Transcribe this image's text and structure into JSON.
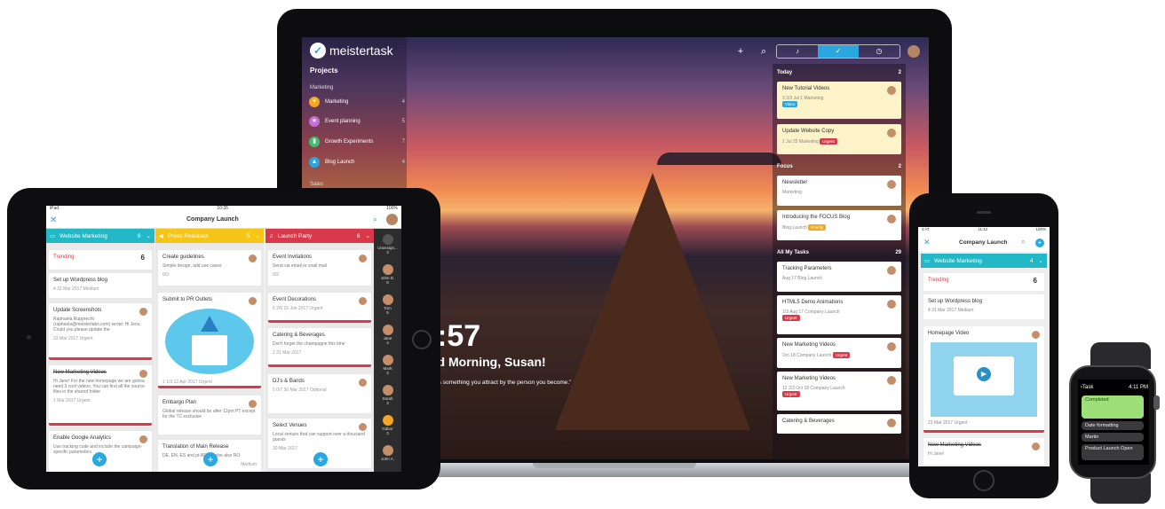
{
  "laptop": {
    "brand": "meistertask",
    "sidebar": {
      "projects_label": "Projects",
      "section_marketing": "Marketing",
      "items": [
        {
          "label": "Marketing",
          "count": "4",
          "icon": "megaphone-icon",
          "color": "#f5a623"
        },
        {
          "label": "Event planning",
          "count": "5",
          "icon": "star-icon",
          "color": "#c86dd7"
        },
        {
          "label": "Growth Experiments",
          "count": "7",
          "icon": "chart-icon",
          "color": "#3fbf6b"
        },
        {
          "label": "Blog Launch",
          "count": "4",
          "icon": "rocket-icon",
          "color": "#2aa7e0"
        }
      ],
      "section_sales": "Sales"
    },
    "clock": ":57",
    "greeting": "od Morning, Susan!",
    "quote": "ss is something you attract by the person you become.\"",
    "panel": {
      "today": {
        "label": "Today",
        "count": "2"
      },
      "focus": {
        "label": "Focus",
        "count": "2"
      },
      "mytasks": {
        "label": "All My Tasks",
        "count": "29"
      },
      "cards": [
        {
          "title": "New Tutorial Videos",
          "meta": "3   3/3   Jul 1   Marketing",
          "tag": "Video",
          "tag_color": "#2aa7e0"
        },
        {
          "title": "Update Website Copy",
          "meta": "1   Jul 25   Marketing",
          "tag": "Urgent",
          "tag_color": "#d93a4b"
        },
        {
          "title": "Newsletter",
          "meta": "Marketing",
          "tag": "",
          "tag_color": ""
        },
        {
          "title": "Introducing the FOCUS Blog",
          "meta": "Blog Launch",
          "tag": "Priority",
          "tag_color": "#f5a623"
        },
        {
          "title": "Tracking Parameters",
          "meta": "Aug 17   Blog Launch",
          "tag": "",
          "tag_color": ""
        },
        {
          "title": "HTML5 Demo Animations",
          "meta": "1/3   Aug 17   Company Launch",
          "tag": "Urgent",
          "tag_color": "#d93a4b"
        },
        {
          "title": "New Marketing Videos",
          "meta": "Oct 18   Company Launch",
          "tag": "Urgent",
          "tag_color": "#d93a4b"
        },
        {
          "title": "New Marketing Videos",
          "meta": "12   2/3   Oct 18   Company Launch",
          "tag": "Urgent",
          "tag_color": "#d93a4b"
        },
        {
          "title": "Catering & Beverages",
          "meta": "",
          "tag": "",
          "tag_color": ""
        }
      ]
    }
  },
  "tablet": {
    "status_left": "iPad",
    "status_time": "10:35",
    "status_right": "100%",
    "title": "Company Launch",
    "columns": [
      {
        "name": "Website Marketing",
        "count": "6",
        "color": "#23b8c6",
        "cards": [
          {
            "title": "Trending",
            "desc": "",
            "meta": "",
            "value": "6"
          },
          {
            "title": "Set up Wordpress blog",
            "desc": "",
            "meta": "4   31 Mar 2017   Medium"
          },
          {
            "title": "Update Screenshots",
            "desc": "Raphaela Rupprecht (raphaela@meisterlabs.com) wrote: Hi Jens, Could you please update the",
            "meta": "23 Mar 2017   Urgent"
          },
          {
            "title": "New Marketing Videos",
            "desc": "Hi Jane! For the new homepage we are gonna need 3 cool videos. You can find all the source files in the shared folder",
            "meta": "1 Mar 2017   Urgent"
          },
          {
            "title": "Enable Google Analytics",
            "desc": "Use tracking code and include the campaign-specific parameters",
            "meta": ""
          }
        ]
      },
      {
        "name": "Press Releases",
        "count": "5",
        "color": "#f5c518",
        "cards": [
          {
            "title": "Create guidelines",
            "desc": "Simple design, add use cases",
            "meta": "0/3"
          },
          {
            "title": "Submit to PR Outlets",
            "desc": "",
            "meta": "1   1/3   12 Apr 2017   Urgent"
          },
          {
            "title": "Embargo Plan",
            "desc": "Global release should be after 12pm PT except for the TC exclusive",
            "meta": ""
          },
          {
            "title": "Translation of Main Release",
            "desc": "DE, EN, ES and pt-BR, maybe also RO",
            "meta": "Medium"
          }
        ]
      },
      {
        "name": "Launch Party",
        "count": "6",
        "color": "#d93a4b",
        "cards": [
          {
            "title": "Event Invitations",
            "desc": "Send via email or snail mail",
            "meta": "0/2"
          },
          {
            "title": "Event Decorations",
            "desc": "",
            "meta": "6   2/6   16 Jun 2017   Urgent"
          },
          {
            "title": "Catering & Beverages",
            "desc": "Don't forget the champagne this time",
            "meta": "2   31 Mar 2017"
          },
          {
            "title": "DJ's & Bands",
            "desc": "",
            "meta": "5   0/7   30 Mar 2017   Optional"
          },
          {
            "title": "Select Venues",
            "desc": "Local venues that can support over a thousand guests",
            "meta": "30 Mar 2017"
          }
        ]
      }
    ],
    "members": [
      {
        "name": "Unassign...",
        "count": "3"
      },
      {
        "name": "John D.",
        "count": "8"
      },
      {
        "name": "Tom",
        "count": "5"
      },
      {
        "name": "Jane",
        "count": "4"
      },
      {
        "name": "Mark",
        "count": "3"
      },
      {
        "name": "Sarah",
        "count": "3"
      },
      {
        "name": "Gábor",
        "count": "3"
      },
      {
        "name": "John A.",
        "count": ""
      }
    ]
  },
  "phone": {
    "status_left": "3 AT",
    "status_time": "11:42",
    "status_right": "100%",
    "title": "Company Launch",
    "column": {
      "name": "Website Marketing",
      "count": "4"
    },
    "cards": [
      {
        "title": "Trending",
        "meta": "",
        "value": "6"
      },
      {
        "title": "Set up Wordpress blog",
        "meta": "4   31 Mar 2017   Medium"
      },
      {
        "title": "Homepage Video",
        "meta": "23 Mar 2017   Urgent"
      },
      {
        "title": "New Marketing Videos",
        "meta": "Hi Jane!"
      }
    ]
  },
  "watch": {
    "back": "Task",
    "time": "4:11 PM",
    "items": [
      {
        "label": "Completed",
        "color": "#9de07a"
      },
      {
        "label": "Date formatting",
        "color": "#3a3a3c"
      },
      {
        "label": "Martin",
        "color": "#3a3a3c"
      },
      {
        "label": "Product Launch Open",
        "color": "#3a3a3c"
      }
    ]
  }
}
